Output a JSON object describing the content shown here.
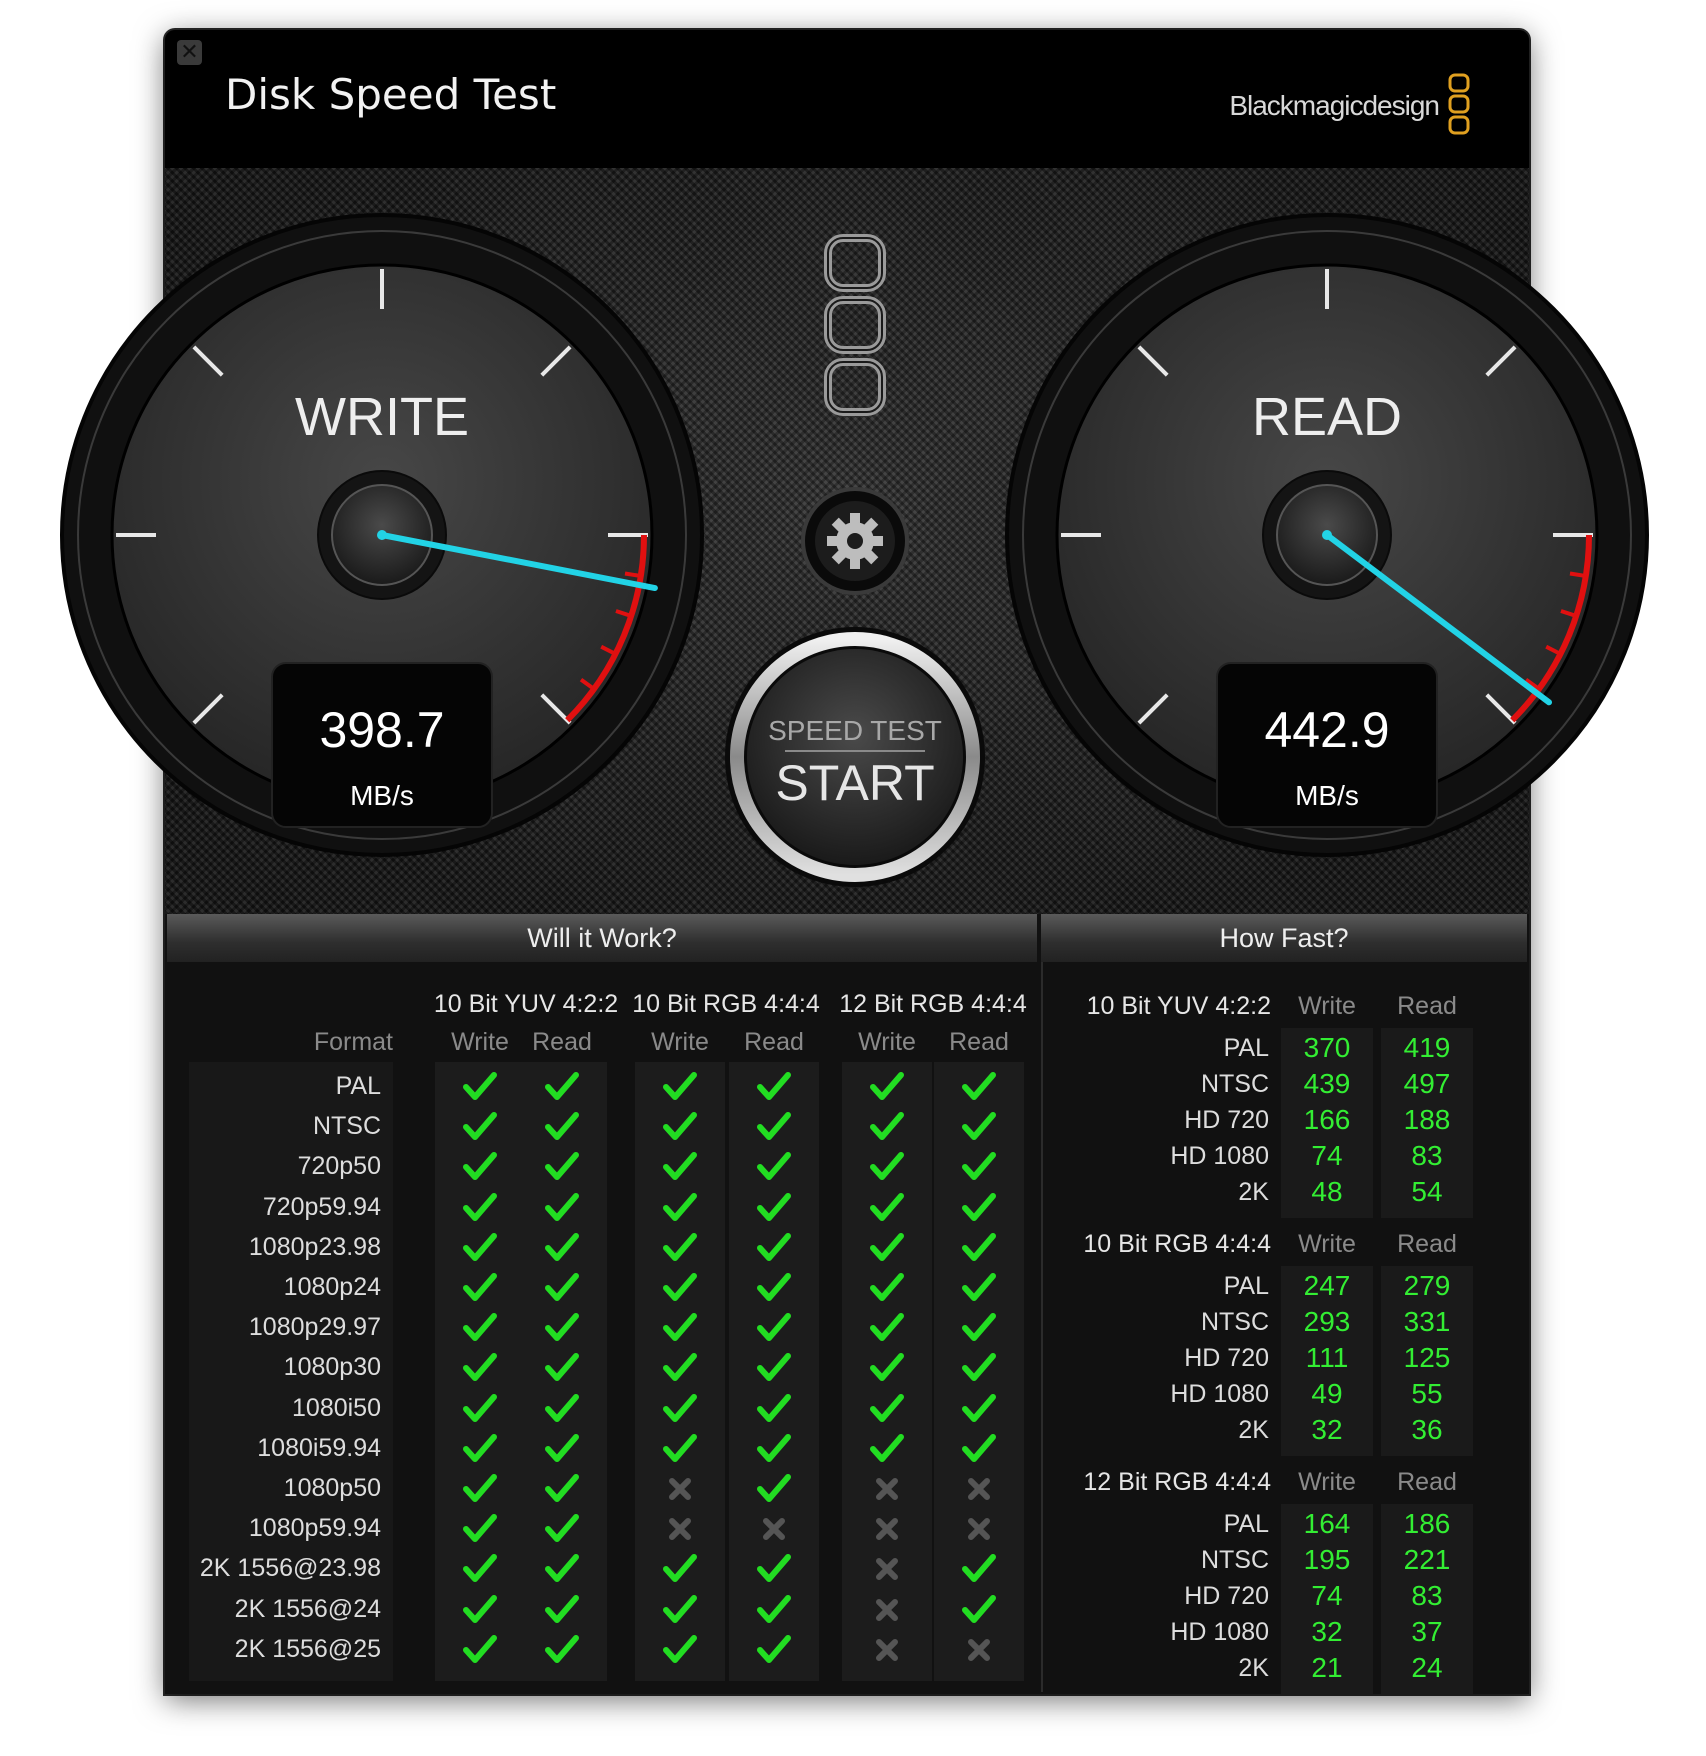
{
  "window": {
    "title": "Disk Speed Test",
    "brand": "Blackmagicdesign",
    "close_symbol": "✕"
  },
  "colors": {
    "needle": "#22d3e6",
    "redline": "#e01010",
    "value_green": "#33ee33",
    "check_green": "#22dd22",
    "cross_grey": "#555555"
  },
  "gauges": {
    "write": {
      "label": "WRITE",
      "value": "398.7",
      "unit": "MB/s"
    },
    "read": {
      "label": "READ",
      "value": "442.9",
      "unit": "MB/s"
    }
  },
  "controls": {
    "settings_icon": "gear-icon",
    "start_button": {
      "top_label": "SPEED TEST",
      "label": "START"
    }
  },
  "will_it_work": {
    "title": "Will it Work?",
    "format_header": "Format",
    "groups": [
      {
        "name": "10 Bit YUV 4:2:2",
        "sub": [
          "Write",
          "Read"
        ]
      },
      {
        "name": "10 Bit RGB 4:4:4",
        "sub": [
          "Write",
          "Read"
        ]
      },
      {
        "name": "12 Bit RGB 4:4:4",
        "sub": [
          "Write",
          "Read"
        ]
      }
    ],
    "rows": [
      {
        "format": "PAL",
        "marks": [
          1,
          1,
          1,
          1,
          1,
          1
        ]
      },
      {
        "format": "NTSC",
        "marks": [
          1,
          1,
          1,
          1,
          1,
          1
        ]
      },
      {
        "format": "720p50",
        "marks": [
          1,
          1,
          1,
          1,
          1,
          1
        ]
      },
      {
        "format": "720p59.94",
        "marks": [
          1,
          1,
          1,
          1,
          1,
          1
        ]
      },
      {
        "format": "1080p23.98",
        "marks": [
          1,
          1,
          1,
          1,
          1,
          1
        ]
      },
      {
        "format": "1080p24",
        "marks": [
          1,
          1,
          1,
          1,
          1,
          1
        ]
      },
      {
        "format": "1080p29.97",
        "marks": [
          1,
          1,
          1,
          1,
          1,
          1
        ]
      },
      {
        "format": "1080p30",
        "marks": [
          1,
          1,
          1,
          1,
          1,
          1
        ]
      },
      {
        "format": "1080i50",
        "marks": [
          1,
          1,
          1,
          1,
          1,
          1
        ]
      },
      {
        "format": "1080i59.94",
        "marks": [
          1,
          1,
          1,
          1,
          1,
          1
        ]
      },
      {
        "format": "1080p50",
        "marks": [
          1,
          1,
          0,
          1,
          0,
          0
        ]
      },
      {
        "format": "1080p59.94",
        "marks": [
          1,
          1,
          0,
          0,
          0,
          0
        ]
      },
      {
        "format": "2K 1556@23.98",
        "marks": [
          1,
          1,
          1,
          1,
          0,
          1
        ]
      },
      {
        "format": "2K 1556@24",
        "marks": [
          1,
          1,
          1,
          1,
          0,
          1
        ]
      },
      {
        "format": "2K 1556@25",
        "marks": [
          1,
          1,
          1,
          1,
          0,
          0
        ]
      }
    ]
  },
  "how_fast": {
    "title": "How Fast?",
    "groups": [
      {
        "name": "10 Bit YUV 4:2:2",
        "write_label": "Write",
        "read_label": "Read",
        "rows": [
          {
            "format": "PAL",
            "write": "370",
            "read": "419"
          },
          {
            "format": "NTSC",
            "write": "439",
            "read": "497"
          },
          {
            "format": "HD 720",
            "write": "166",
            "read": "188"
          },
          {
            "format": "HD 1080",
            "write": "74",
            "read": "83"
          },
          {
            "format": "2K",
            "write": "48",
            "read": "54"
          }
        ]
      },
      {
        "name": "10 Bit RGB 4:4:4",
        "write_label": "Write",
        "read_label": "Read",
        "rows": [
          {
            "format": "PAL",
            "write": "247",
            "read": "279"
          },
          {
            "format": "NTSC",
            "write": "293",
            "read": "331"
          },
          {
            "format": "HD 720",
            "write": "111",
            "read": "125"
          },
          {
            "format": "HD 1080",
            "write": "49",
            "read": "55"
          },
          {
            "format": "2K",
            "write": "32",
            "read": "36"
          }
        ]
      },
      {
        "name": "12 Bit RGB 4:4:4",
        "write_label": "Write",
        "read_label": "Read",
        "rows": [
          {
            "format": "PAL",
            "write": "164",
            "read": "186"
          },
          {
            "format": "NTSC",
            "write": "195",
            "read": "221"
          },
          {
            "format": "HD 720",
            "write": "74",
            "read": "83"
          },
          {
            "format": "HD 1080",
            "write": "32",
            "read": "37"
          },
          {
            "format": "2K",
            "write": "21",
            "read": "24"
          }
        ]
      }
    ]
  }
}
